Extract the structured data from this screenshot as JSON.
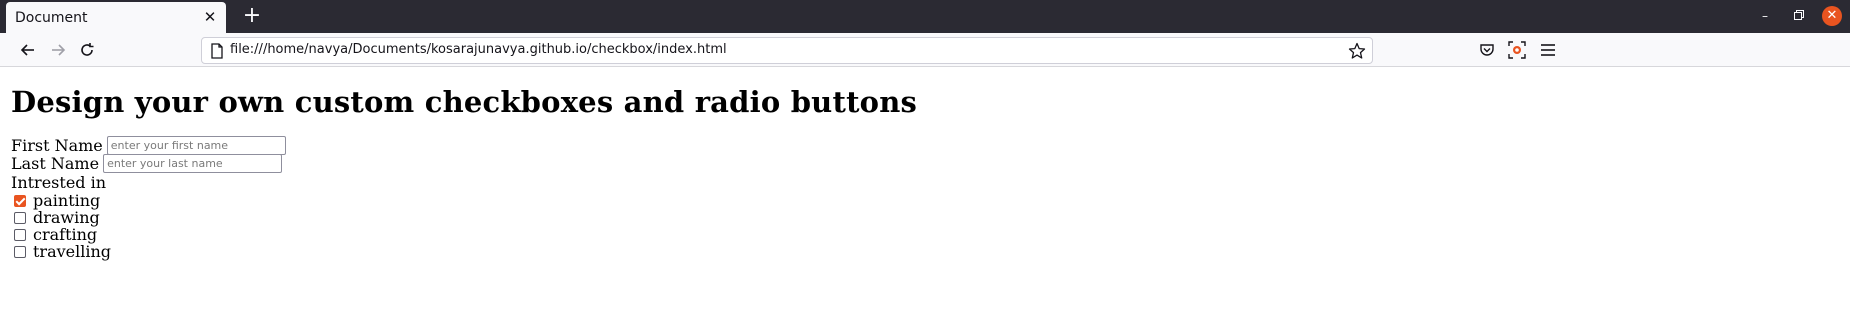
{
  "browser": {
    "tab": {
      "title": "Document"
    },
    "url": "file:///home/navya/Documents/kosarajunavya.github.io/checkbox/index.html",
    "accent_color": "#e95420"
  },
  "page": {
    "title": "Design your own custom checkboxes and radio buttons",
    "first_name": {
      "label": "First Name",
      "placeholder": "enter your first name",
      "value": ""
    },
    "last_name": {
      "label": "Last Name",
      "placeholder": "enter your last name",
      "value": ""
    },
    "interested_label": "Intrested in",
    "options": [
      {
        "label": "painting",
        "checked": true
      },
      {
        "label": "drawing",
        "checked": false
      },
      {
        "label": "crafting",
        "checked": false
      },
      {
        "label": "travelling",
        "checked": false
      }
    ]
  }
}
